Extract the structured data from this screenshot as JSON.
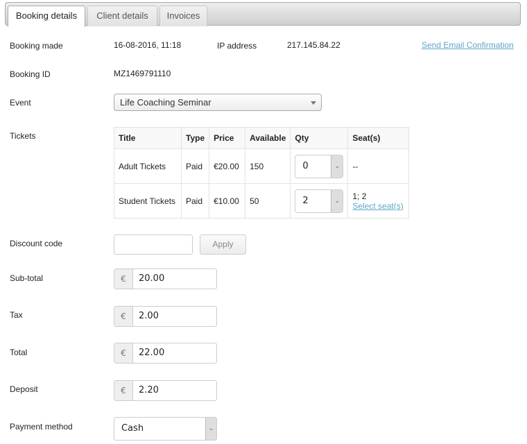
{
  "tabs": [
    {
      "label": "Booking details",
      "active": true
    },
    {
      "label": "Client details",
      "active": false
    },
    {
      "label": "Invoices",
      "active": false
    }
  ],
  "booking": {
    "booking_made_label": "Booking made",
    "booking_made_value": "16-08-2016, 11:18",
    "ip_label": "IP address",
    "ip_value": "217.145.84.22",
    "send_email_link": "Send Email Confirmation",
    "booking_id_label": "Booking ID",
    "booking_id_value": "MZ1469791110",
    "event_label": "Event",
    "event_value": "Life Coaching Seminar",
    "tickets_label": "Tickets"
  },
  "tickets": {
    "columns": [
      "Title",
      "Type",
      "Price",
      "Available",
      "Qty",
      "Seat(s)"
    ],
    "rows": [
      {
        "title": "Adult Tickets",
        "type": "Paid",
        "price": "€20.00",
        "available": "150",
        "qty": "0",
        "seats": "--",
        "select_link": ""
      },
      {
        "title": "Student Tickets",
        "type": "Paid",
        "price": "€10.00",
        "available": "50",
        "qty": "2",
        "seats": "1; 2",
        "select_link": "Select seat(s)"
      }
    ]
  },
  "discount": {
    "label": "Discount code",
    "value": "",
    "apply_label": "Apply"
  },
  "currency_symbol": "€",
  "amounts": {
    "subtotal_label": "Sub-total",
    "subtotal_value": "20.00",
    "tax_label": "Tax",
    "tax_value": "2.00",
    "total_label": "Total",
    "total_value": "22.00",
    "deposit_label": "Deposit",
    "deposit_value": "2.20"
  },
  "payment": {
    "label": "Payment method",
    "value": "Cash"
  },
  "colors": {
    "link": "#5ea5c9"
  }
}
